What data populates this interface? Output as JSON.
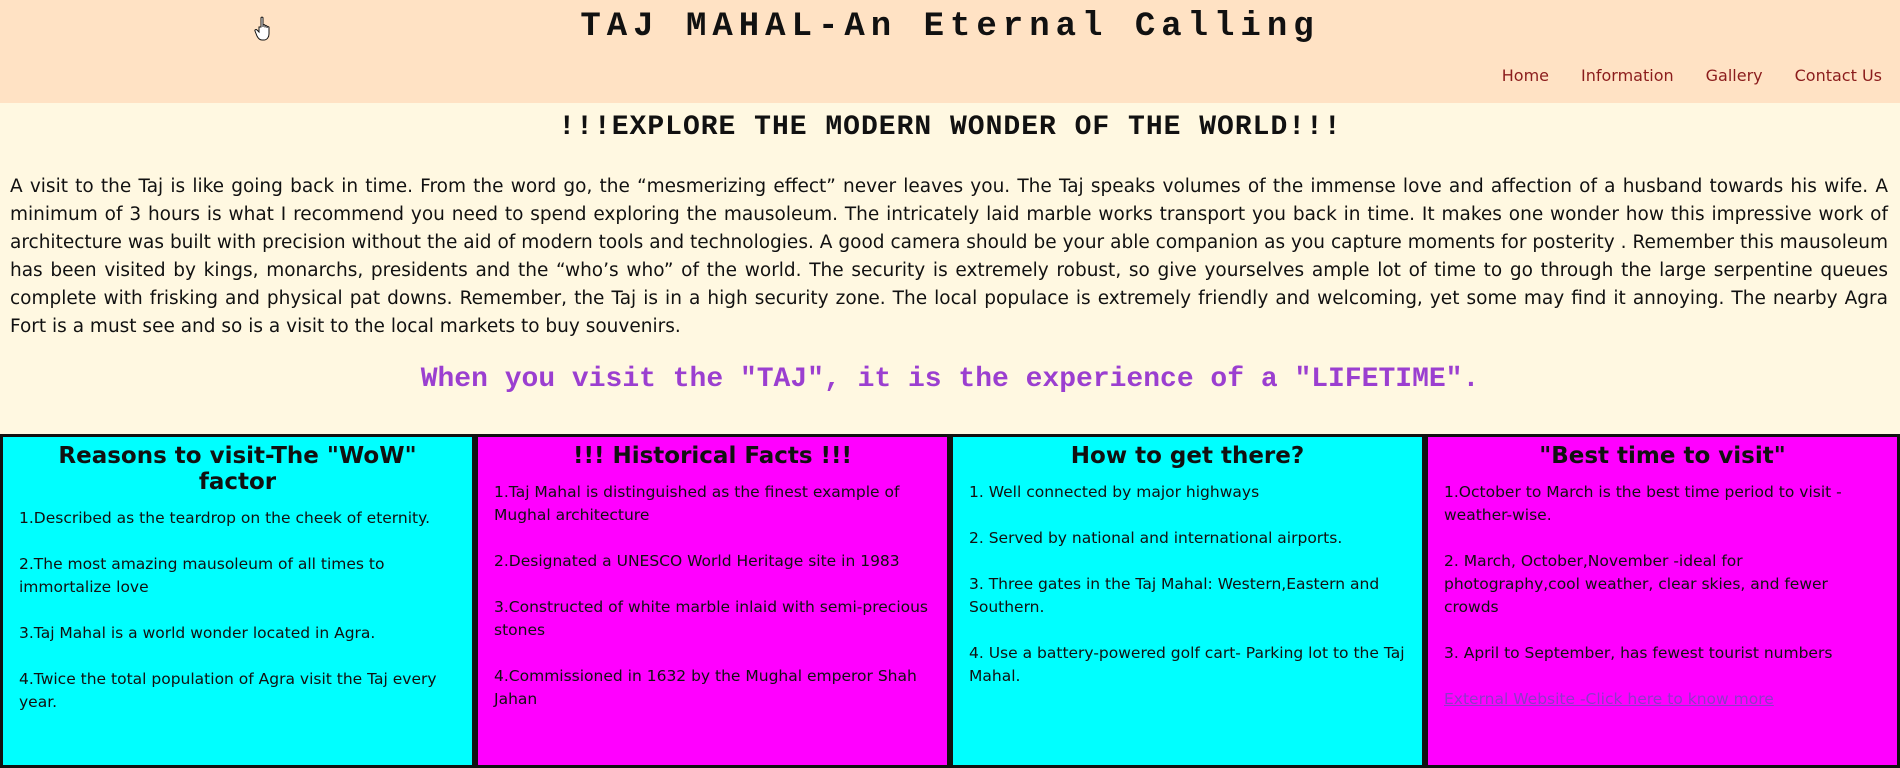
{
  "header": {
    "title": "TAJ MAHAL-An Eternal Calling",
    "nav": [
      "Home",
      "Information",
      "Gallery",
      "Contact Us"
    ]
  },
  "main": {
    "heading": "!!!EXPLORE THE MODERN WONDER OF THE WORLD!!!",
    "intro": "A visit to the Taj is like going back in time. From the word go, the “mesmerizing effect” never leaves you. The Taj speaks volumes of the immense love and affection of a husband towards his wife. A minimum of 3 hours is what I recommend you need to spend exploring the mausoleum. The intricately laid marble works transport you back in time. It makes one wonder how this impressive work of architecture was built with precision without the aid of modern tools and technologies. A good camera should be your able companion as you capture moments for posterity . Remember this mausoleum has been visited by kings, monarchs, presidents and the “who’s who” of the world. The security is extremely robust, so give yourselves ample lot of time to go through the large serpentine queues complete with frisking and physical pat downs. Remember, the Taj is in a high security zone. The local populace is extremely friendly and welcoming, yet some may find it annoying. The nearby Agra Fort is a must see and so is a visit to the local markets to buy souvenirs.",
    "tagline": "When you visit the \"TAJ\", it is the experience of a \"LIFETIME\"."
  },
  "cards": [
    {
      "title": "Reasons to visit-The \"WoW\" factor",
      "items": [
        "1.Described as the teardrop on the cheek of eternity.",
        "2.The most amazing mausoleum of all times to immortalize love",
        "3.Taj Mahal is a world wonder located in Agra.",
        "4.Twice the total population of Agra visit the Taj every year."
      ]
    },
    {
      "title": "!!! Historical Facts !!!",
      "items": [
        "1.Taj Mahal is distinguished as the finest example of Mughal architecture",
        "2.Designated a UNESCO World Heritage site in 1983",
        "3.Constructed of white marble inlaid with semi-precious stones",
        "4.Commissioned in 1632 by the Mughal emperor Shah Jahan"
      ]
    },
    {
      "title": "How to get there?",
      "items": [
        "1. Well connected by major highways",
        "2. Served by national and international airports.",
        "3. Three gates in the Taj Mahal: Western,Eastern and Southern.",
        "4. Use a battery-powered golf cart- Parking lot to the Taj Mahal."
      ]
    },
    {
      "title": "\"Best time to visit\"",
      "items": [
        "1.October to March is the best time period to visit - weather-wise.",
        "2. March, October,November -ideal for photography,cool weather, clear skies, and fewer crowds",
        "3. April to September, has fewest tourist numbers"
      ],
      "link": "External Website -Click here to know more"
    }
  ],
  "colors": {
    "header_bg": "#ffe2c4",
    "page_bg": "#fff8e1",
    "nav_link": "#8b1c1c",
    "tagline": "#9b3fd0",
    "card_cyan": "#00ffff",
    "card_magenta": "#ff00ff"
  }
}
